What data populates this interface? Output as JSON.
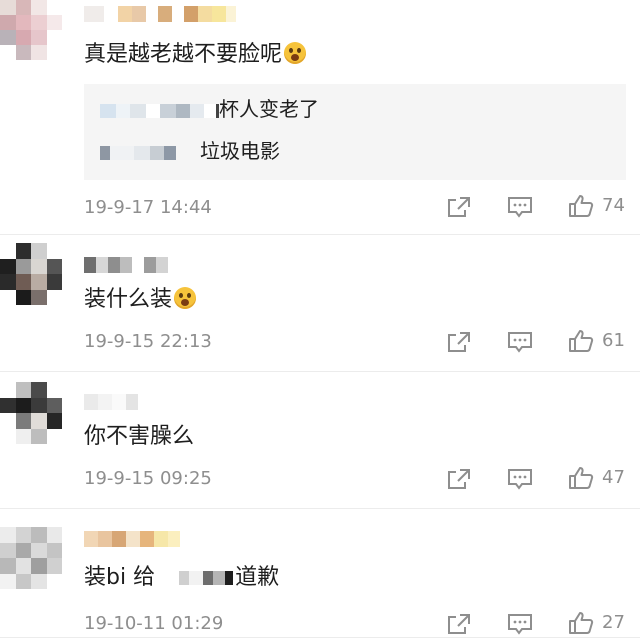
{
  "comments": [
    {
      "text": "真是越老越不要脸呢",
      "emoji": "scared-face",
      "replies": [
        {
          "text": "杯人变老了"
        },
        {
          "text": "垃圾电影"
        }
      ],
      "time": "19-9-17 14:44",
      "likes": "74"
    },
    {
      "text": "装什么装",
      "emoji": "scared-face",
      "time": "19-9-15 22:13",
      "likes": "61"
    },
    {
      "text": "你不害臊么",
      "time": "19-9-15 09:25",
      "likes": "47"
    },
    {
      "text_prefix": "装bi 给",
      "text_suffix": "道歉",
      "time": "19-10-11 01:29",
      "likes": "27"
    }
  ],
  "colors": {
    "timestamp": "#8e8e8e",
    "reply_background": "#f5f5f5",
    "icon": "#8e8e8e"
  },
  "icons": [
    "share-icon",
    "comment-icon",
    "like-icon"
  ]
}
